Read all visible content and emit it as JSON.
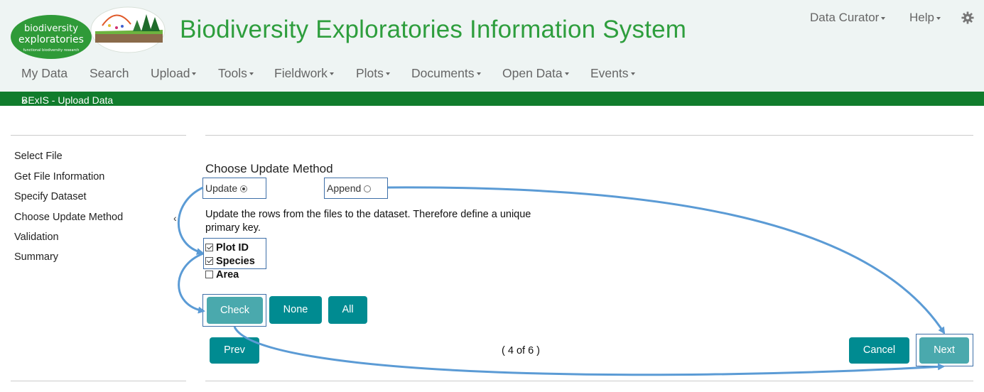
{
  "header": {
    "logo_text_line1": "biodiversity",
    "logo_text_line2": "exploratories",
    "logo_tagline": "functional biodiversity research",
    "title": "Biodiversity Exploratories Information System",
    "user_menu": "Data Curator",
    "help_menu": "Help",
    "settings_icon": "gear-icon"
  },
  "nav": {
    "items": [
      "My Data",
      "Search",
      "Upload",
      "Tools",
      "Fieldwork",
      "Plots",
      "Documents",
      "Open Data",
      "Events"
    ]
  },
  "breadcrumb": {
    "label": "BExIS - Upload Data",
    "icon": "double-chevron-down-icon"
  },
  "steps": {
    "items": [
      "Select File",
      "Get File Information",
      "Specify Dataset",
      "Choose Update Method",
      "Validation",
      "Summary"
    ],
    "active_marker": "‹"
  },
  "update_method": {
    "title": "Choose Update Method",
    "options": {
      "update": "Update",
      "append": "Append",
      "selected": "update"
    },
    "description": "Update the rows from the files to the dataset. Therefore define a unique primary key.",
    "keys": [
      {
        "label": "Plot ID",
        "checked": true
      },
      {
        "label": "Species",
        "checked": true
      },
      {
        "label": "Area",
        "checked": false
      }
    ],
    "buttons": {
      "check": "Check",
      "none": "None",
      "all": "All"
    }
  },
  "wizard": {
    "prev": "Prev",
    "progress": "( 4 of 6 )",
    "cancel": "Cancel",
    "next": "Next"
  },
  "colors": {
    "brand_green": "#2e9e3d",
    "bar_green": "#107c2c",
    "button_teal": "#008b91",
    "annotation_blue": "#5b9bd5"
  }
}
